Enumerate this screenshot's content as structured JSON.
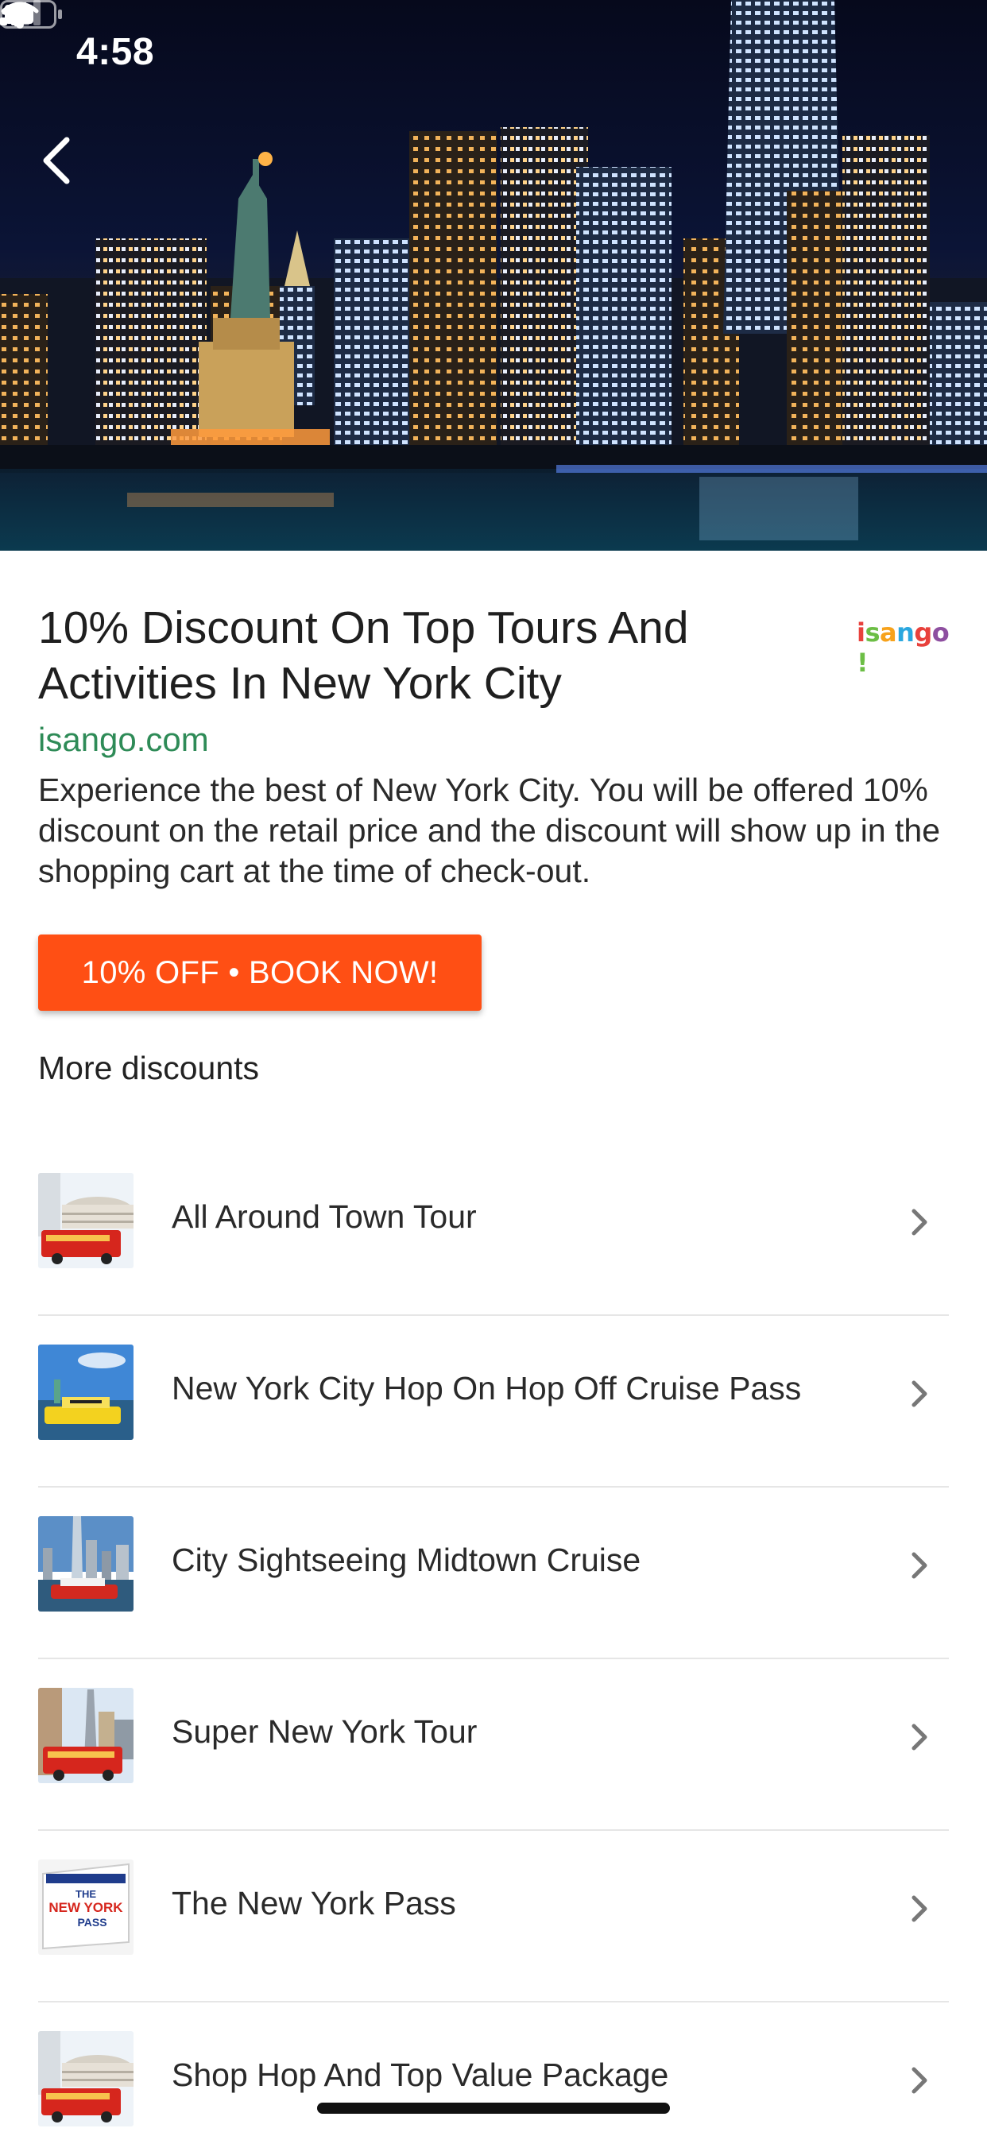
{
  "status_bar": {
    "time": "4:58",
    "icons": [
      "location-arrow-icon",
      "cellular-signal-icon",
      "wifi-icon",
      "battery-icon"
    ]
  },
  "hero": {
    "image": "New York City skyline at night with Statue of Liberty"
  },
  "navigation": {
    "back_icon": "chevron-left-icon"
  },
  "ad": {
    "title": "10% Discount On Top Tours And Activities In New York City",
    "brand_logo": [
      "i",
      "s",
      "a",
      "n",
      "g",
      "o",
      "!"
    ],
    "domain": "isango.com",
    "description": "Experience the best of New York City. You will be offered 10% discount on the retail price and the discount will show up in the shopping cart at the time of check-out.",
    "cta_label": "10% OFF • BOOK NOW!",
    "cta_color": "#ff4f14",
    "domain_color": "#2e8b57"
  },
  "more": {
    "heading": "More discounts",
    "items": [
      {
        "label": "All Around Town Tour"
      },
      {
        "label": "New York City Hop On Hop Off Cruise Pass"
      },
      {
        "label": "City Sightseeing Midtown Cruise"
      },
      {
        "label": "Super New York Tour"
      },
      {
        "label": "The New York Pass"
      },
      {
        "label": "Shop Hop And Top Value Package"
      }
    ]
  },
  "thumb_pass_text": [
    "THE",
    "NEW YORK",
    "PASS"
  ]
}
